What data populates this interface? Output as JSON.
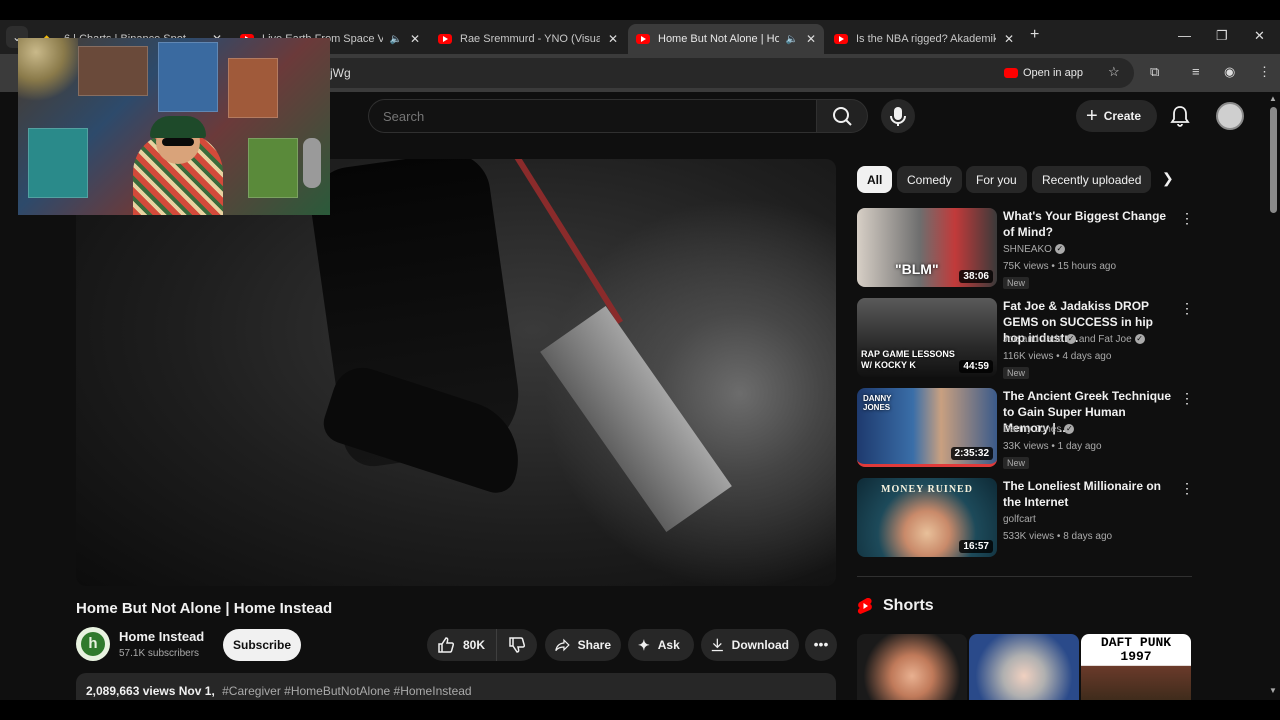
{
  "browser": {
    "tabs": [
      {
        "title": "6 | Charts | Binance Spot",
        "favicon": "binance-icon",
        "active": false,
        "audio": false
      },
      {
        "title": "Live Earth From Space Vide",
        "favicon": "youtube-icon",
        "active": false,
        "audio": true
      },
      {
        "title": "Rae Sremmurd - YNO (Visualize",
        "favicon": "youtube-icon",
        "active": false,
        "audio": false
      },
      {
        "title": "Home But Not Alone | Hom",
        "favicon": "youtube-icon",
        "active": true,
        "audio": true
      },
      {
        "title": "Is the NBA rigged? Akademiks",
        "favicon": "youtube-icon",
        "active": false,
        "audio": false
      }
    ],
    "url_fragment": "jWg",
    "open_in_app_label": "Open in app"
  },
  "youtube": {
    "search_placeholder": "Search",
    "create_label": "Create",
    "video": {
      "title": "Home But Not Alone | Home Instead",
      "channel_name": "Home Instead",
      "channel_initial": "h",
      "subscribers": "57.1K subscribers",
      "subscribe_label": "Subscribe",
      "likes": "80K",
      "share_label": "Share",
      "ask_label": "Ask",
      "download_label": "Download",
      "views": "2,089,663 views",
      "date": "Nov 1,",
      "hashtags": "#Caregiver #HomeButNotAlone #HomeInstead"
    },
    "chips": [
      {
        "label": "All",
        "active": true
      },
      {
        "label": "Comedy",
        "active": false
      },
      {
        "label": "For you",
        "active": false
      },
      {
        "label": "Recently uploaded",
        "active": false
      }
    ],
    "recommendations": [
      {
        "title": "What's Your Biggest Change of Mind?",
        "channel": "SHNEAKO",
        "verified": true,
        "meta": "75K views • 15 hours ago",
        "badge": "New",
        "duration": "38:06",
        "thumb_text": "\"BLM\""
      },
      {
        "title": "Fat Joe & Jadakiss DROP GEMS on SUCCESS in hip hop industr...",
        "channel": "Joe and Jada",
        "verified": true,
        "channel_extra": "and Fat Joe",
        "meta": "116K views • 4 days ago",
        "badge": "New",
        "duration": "44:59",
        "thumb_text": "RAP GAME LESSONS W/ KOCKY K"
      },
      {
        "title": "The Ancient Greek Technique to Gain Super Human Memory | ...",
        "channel": "Danny Jones",
        "verified": true,
        "meta": "33K views • 1 day ago",
        "badge": "New",
        "duration": "2:35:32",
        "thumb_text": "DANNY JONES"
      },
      {
        "title": "The Loneliest Millionaire on the Internet",
        "channel": "golfcart",
        "verified": false,
        "meta": "533K views • 8 days ago",
        "badge": "",
        "duration": "16:57",
        "thumb_text": "MONEY RUINED"
      }
    ],
    "shorts_title": "Shorts",
    "shorts_overlay_text": "DAFT PUNK 1997"
  },
  "colors": {
    "youtube_red": "#ff0000",
    "page_bg": "#0f0f0f",
    "chip_bg": "#272727",
    "tab_active_bg": "#3b3b3b"
  }
}
